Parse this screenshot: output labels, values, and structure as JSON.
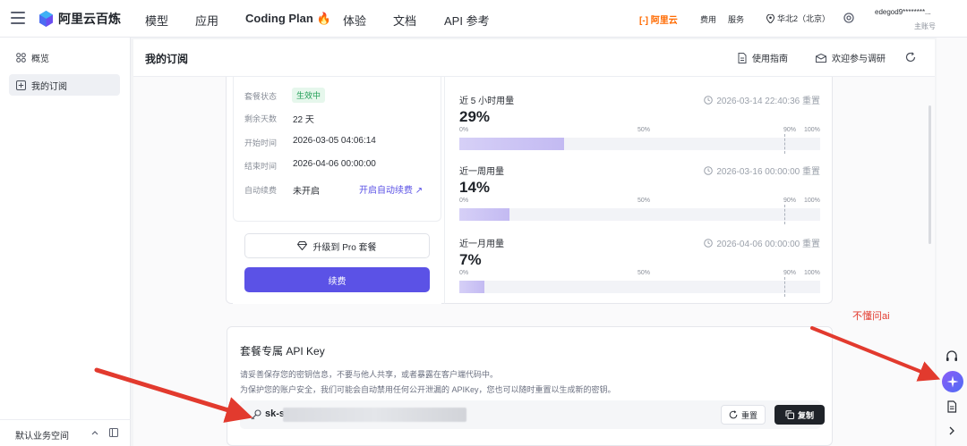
{
  "topbar": {
    "brand": "阿里云百炼",
    "nav": [
      "模型",
      "应用",
      "Coding Plan 🔥",
      "体验",
      "文档",
      "API 参考"
    ],
    "aliyun_logo": "[-] 阿里云",
    "fees": "费用",
    "service": "服务",
    "region": "华北2（北京）",
    "user": "edegod9********...",
    "user_sub": "主账号"
  },
  "sidebar": {
    "items": [
      {
        "label": "概览",
        "icon": "grid-icon"
      },
      {
        "label": "我的订阅",
        "icon": "subscription-icon"
      }
    ],
    "space": "默认业务空间"
  },
  "header": {
    "title": "我的订阅",
    "guide": "使用指南",
    "survey": "欢迎参与调研"
  },
  "subscription": {
    "status_label": "套餐状态",
    "status_value": "生效中",
    "days_label": "剩余天数",
    "days_value": "22 天",
    "start_label": "开始时间",
    "start_value": "2026-03-05 04:06:14",
    "end_label": "结束时间",
    "end_value": "2026-04-06 00:00:00",
    "auto_label": "自动续费",
    "auto_value": "未开启",
    "auto_link": "开启自动续费 ↗",
    "upgrade": "升级到 Pro 套餐",
    "renew": "续费"
  },
  "usage": [
    {
      "title": "近 5 小时用量",
      "reset": "2026-03-14 22:40:36 重置",
      "pct": "29%",
      "value": 0.29
    },
    {
      "title": "近一周用量",
      "reset": "2026-03-16 00:00:00 重置",
      "pct": "14%",
      "value": 0.14
    },
    {
      "title": "近一月用量",
      "reset": "2026-04-06 00:00:00 重置",
      "pct": "7%",
      "value": 0.07
    }
  ],
  "ticks": {
    "t0": "0%",
    "t50": "50%",
    "t90": "90%",
    "t100": "100%"
  },
  "api": {
    "title": "套餐专属 API Key",
    "line1": "请妥善保存您的密钥信息，不要与他人共享，或者暴露在客户端代码中。",
    "line2": "为保护您的账户安全，我们可能会自动禁用任何公开泄漏的 APIKey，您也可以随时重置以生成新的密钥。",
    "key_prefix": "sk-s",
    "reset": "重置",
    "copy": "复制"
  },
  "annotation": "不懂问ai",
  "colors": {
    "accent": "#5b52e6",
    "annotation": "#e23a2e",
    "success": "#1f9d55"
  }
}
